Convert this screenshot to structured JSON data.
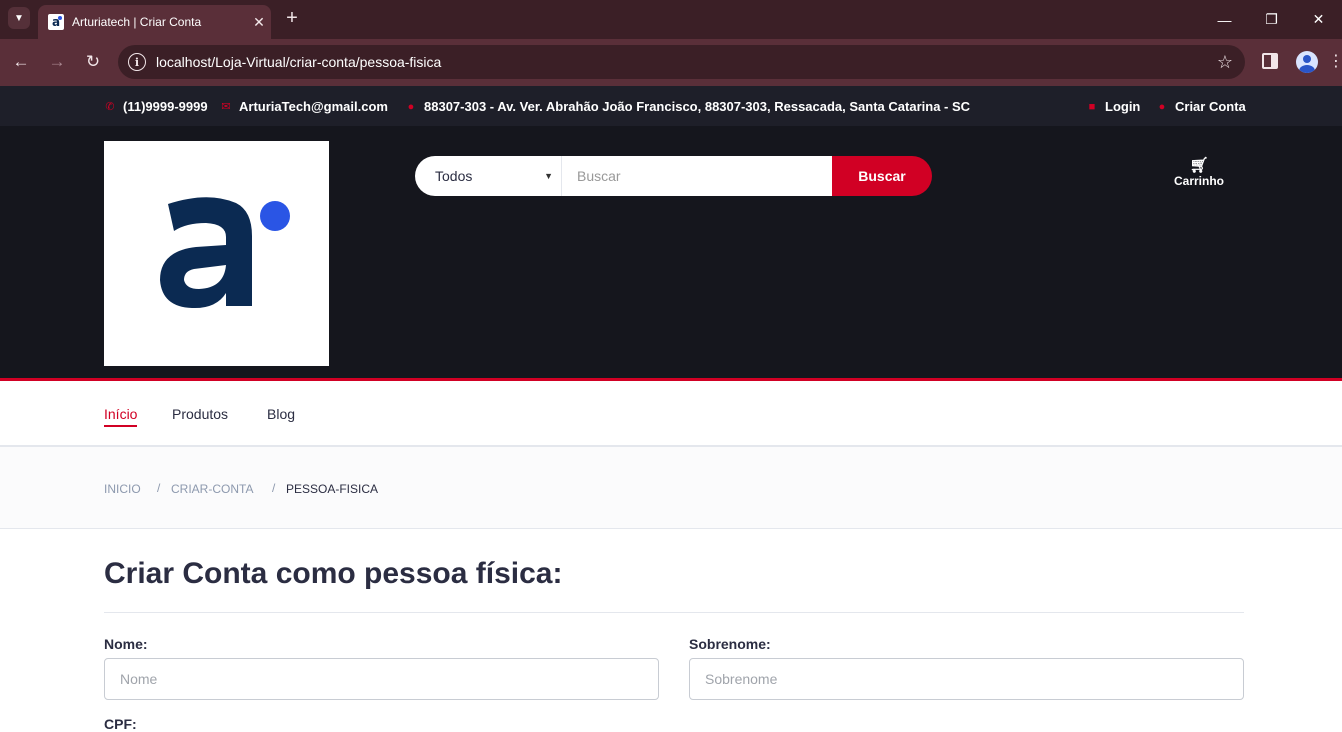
{
  "browser": {
    "tab_title": "Arturiatech | Criar Conta",
    "url": "localhost/Loja-Virtual/criar-conta/pessoa-fisica"
  },
  "top_strip": {
    "phone": "(11)9999-9999",
    "email": "ArturiaTech@gmail.com",
    "address": "88307-303 - Av. Ver. Abrahão João Francisco, 88307-303, Ressacada, Santa Catarina - SC",
    "login": "Login",
    "create_account": "Criar Conta"
  },
  "header": {
    "search_category": "Todos",
    "search_placeholder": "Buscar",
    "search_button": "Buscar",
    "cart_label": "Carrinho"
  },
  "nav": {
    "items": [
      "Início",
      "Produtos",
      "Blog"
    ]
  },
  "breadcrumb": [
    "INICIO",
    "CRIAR-CONTA",
    "PESSOA-FISICA"
  ],
  "form": {
    "title": "Criar Conta como pessoa física:",
    "nome_label": "Nome:",
    "nome_placeholder": "Nome",
    "sobrenome_label": "Sobrenome:",
    "sobrenome_placeholder": "Sobrenome",
    "cpf_label": "CPF:"
  },
  "colors": {
    "accent": "#d10024",
    "header_bg": "#15161d",
    "strip_bg": "#1e1f29",
    "logo_navy": "#0b2a52",
    "logo_dot": "#2a55e5"
  }
}
